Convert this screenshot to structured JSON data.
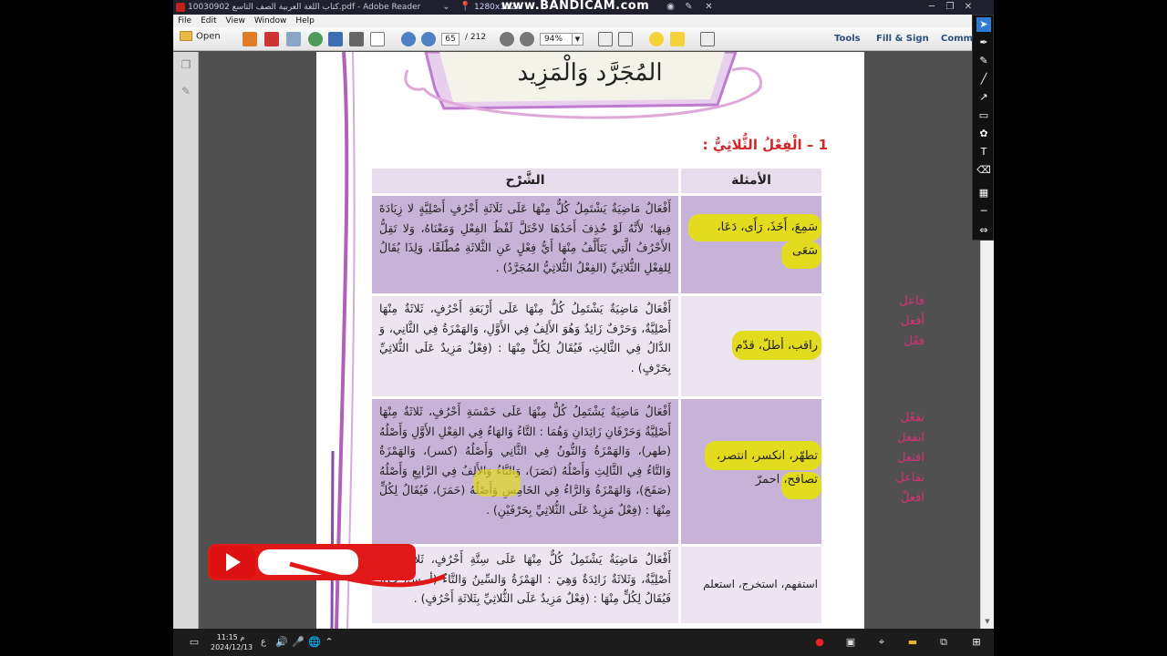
{
  "window": {
    "title": "10030902 كتاب اللغة العربية الصف التاسع.pdf - Adobe Reader",
    "recorder_resolution": "1280x1024",
    "recorder_logo": "www.BANDICAM.com"
  },
  "menu": [
    "File",
    "Edit",
    "View",
    "Window",
    "Help"
  ],
  "toolbar": {
    "open_label": "Open",
    "page_current": "65",
    "page_total": "/ 212",
    "zoom": "94%",
    "tools_label": "Tools",
    "fill_sign_label": "Fill & Sign",
    "comment_label": "Comm"
  },
  "document": {
    "title": "المُجَرَّد وَالْمَزِيد",
    "section_heading": "1 – الْفِعْلُ الثُّلاثِيُّ :",
    "col_examples": "الأمثلة",
    "col_explanation": "الشَّرْح",
    "rows": [
      {
        "examples": "سَمِعَ، أَخَذَ، رَأَى، دَعَا، سَعَى",
        "explanation": "أَفْعَالٌ مَاضِيَةٌ يَشْتَمِلُ كُلٌّ مِنْهَا عَلَى ثَلَاثَةِ أَحْرُفٍ أَصْلِيَّةٍ لا زِيَادَةَ فِيهَا؛ لأَنَّهُ لَوْ حُذِفَ أَحَدُهَا لاخْتَلَّ لَفْظُ الفِعْلِ وَمَعْنَاهُ، وَلا تَقِلُّ الأَحْرُفُ الَّتِي يَتَأَلَّفُ مِنْهَا أَيُّ فِعْلٍ عَنِ الثَّلاثَةِ مُطْلَقًا، وَلِذَا يُقَالُ لِلفِعْلِ الثُّلاثِيِّ (الفِعْلُ الثُّلاثِيُّ المُجَرَّدُ) ."
      },
      {
        "examples": "راقب، أطلّ، قدّم",
        "explanation": "أَفْعَالٌ مَاضِيَةٌ يَشْتَمِلُ كُلٌّ مِنْهَا عَلَى أَرْبَعَةِ أَحْرُفٍ، ثَلاثَةٌ مِنْهَا أَصْلِيَّةٌ، وَحَرْفٌ زَائِدٌ وَهُوَ الأَلِفُ فِي الأَوَّلِ، وَالهَمْزَةُ فِي الثَّانِي، وَ الدَّالُ فِي الثَّالِثِ، فَيُقَالُ لِكُلٍّ مِنْهَا : (فِعْلٌ مَزِيدٌ عَلَى الثُّلاثِيِّ بِحَرْفٍ) ."
      },
      {
        "examples": "تطهّر، انكسر، انتصر، تصافح، احمرّ",
        "explanation": "أَفْعَالٌ مَاضِيَةٌ يَشْتَمِلُ كُلٌّ مِنْهَا عَلَى خَمْسَةِ أَحْرُفٍ، ثَلاثَةٌ مِنْهَا أَصْلِيَّةٌ وَحَرْفَانِ زَائِدَانِ وَهُمَا : التَّاءُ وَالهَاءُ فِي الفِعْلِ الأَوَّلِ وَأَصْلُهُ (طهر)، وَالهَمْزَةُ وَالنُّونُ فِي الثَّانِي وَأَصْلُهُ (كسر)، وَالهَمْزَةُ وَالتَّاءُ فِي الثَّالِثِ وَأَصْلُهُ (نَصَرَ)، وَالتَّاءُ وَالأَلِفُ فِي الرَّابِعِ وَأَصْلُهُ (صَفَحَ)، وَالهَمْزَةُ وَالرَّاءُ فِي الخَامِسِ وَأَصْلُهُ (حَمَرَ)، فَيُقَالُ لِكُلٍّ مِنْهَا : (فِعْلٌ مَزِيدٌ عَلَى الثُّلاثِيِّ بِحَرْفَيْنِ) ."
      },
      {
        "examples": "استفهم، استخرج، استعلم",
        "explanation": "أَفْعَالٌ مَاضِيَةٌ يَشْتَمِلُ كُلٌّ مِنْهَا عَلَى سِتَّةِ أَحْرُفٍ، ثَلاثَةٌ مِنْهَا أَصْلِيَّةٌ، وَثَلاثَةٌ زَائِدَةٌ وَهِيَ : الهَمْزَةُ وَالسِّينُ وَالتَّاءُ (أ، س، ت)، فَيُقَالُ لِكُلٍّ مِنْهَا : (فِعْلٌ مَزِيدٌ عَلَى الثُّلاثِيِّ بِثَلاثَةِ أَحْرُفٍ) ."
      }
    ],
    "margin_notes_1": [
      "فاعل",
      "أفعل",
      "فعّل"
    ],
    "margin_notes_2": [
      "تفعّل",
      "انفعل",
      "افتعل",
      "تفاعل",
      "افعلّ"
    ]
  },
  "taskbar": {
    "time": "11:15",
    "am_pm": "م",
    "date": "2024/12/13",
    "lang": "ع"
  },
  "colors": {
    "row_dark": "#c8b3d8",
    "row_light": "#ece4f1",
    "highlight": "#e3dc1e",
    "heading_red": "#d2262b",
    "ink_pink": "#ef2b7e"
  }
}
